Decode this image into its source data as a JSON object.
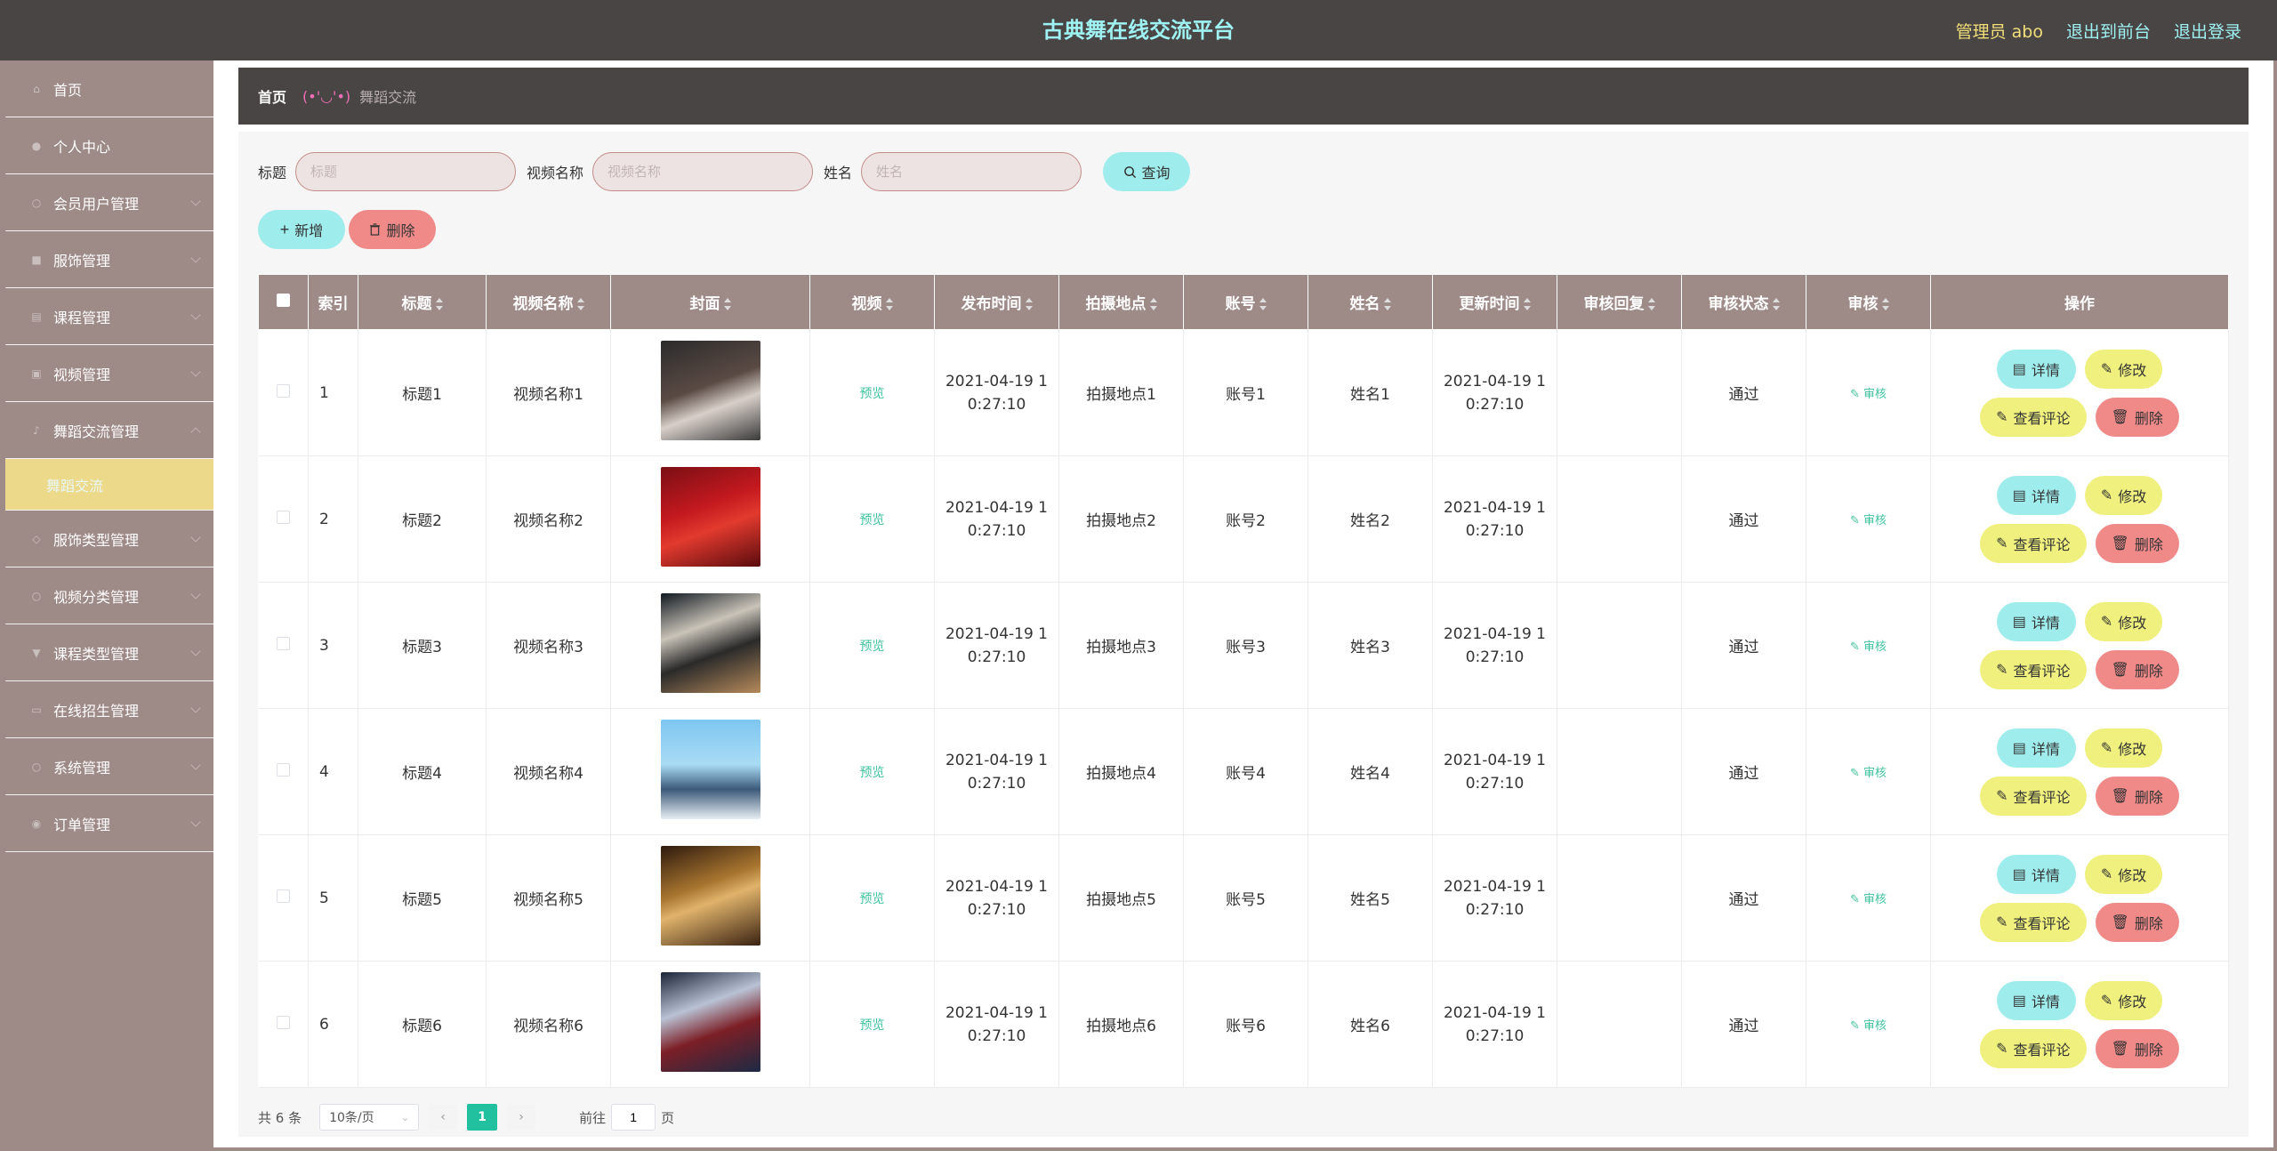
{
  "header": {
    "title": "古典舞在线交流平台",
    "admin_label": "管理员 abo",
    "to_front": "退出到前台",
    "logout": "退出登录"
  },
  "sidebar": {
    "items": [
      {
        "label": "首页",
        "icon": "home-icon"
      },
      {
        "label": "个人中心",
        "icon": "user-icon"
      },
      {
        "label": "会员用户管理",
        "icon": "users-icon"
      },
      {
        "label": "服饰管理",
        "icon": "shirt-icon"
      },
      {
        "label": "课程管理",
        "icon": "book-icon"
      },
      {
        "label": "视频管理",
        "icon": "video-icon"
      },
      {
        "label": "舞蹈交流管理",
        "icon": "chat-icon"
      },
      {
        "label": "舞蹈交流",
        "icon": ""
      },
      {
        "label": "服饰类型管理",
        "icon": "tag-icon"
      },
      {
        "label": "视频分类管理",
        "icon": "folder-icon"
      },
      {
        "label": "课程类型管理",
        "icon": "list-icon"
      },
      {
        "label": "在线招生管理",
        "icon": "school-icon"
      },
      {
        "label": "系统管理",
        "icon": "gear-icon"
      },
      {
        "label": "订单管理",
        "icon": "cart-icon"
      }
    ]
  },
  "breadcrumb": {
    "home": "首页",
    "separator": "(•'◡'•)",
    "current": "舞蹈交流"
  },
  "search": {
    "title_label": "标题",
    "title_placeholder": "标题",
    "video_label": "视频名称",
    "video_placeholder": "视频名称",
    "name_label": "姓名",
    "name_placeholder": "姓名",
    "query_button": "查询"
  },
  "actions": {
    "add": "新增",
    "delete": "删除"
  },
  "table": {
    "headers": {
      "index": "索引",
      "title": "标题",
      "video_name": "视频名称",
      "cover": "封面",
      "video": "视频",
      "publish_time": "发布时间",
      "location": "拍摄地点",
      "account": "账号",
      "name": "姓名",
      "update_time": "更新时间",
      "audit_reply": "审核回复",
      "audit_status": "审核状态",
      "audit": "审核",
      "ops": "操作"
    },
    "labels": {
      "preview": "预览",
      "audit_link": "审核",
      "detail": "详情",
      "edit": "修改",
      "comments": "查看评论",
      "delete": "删除"
    },
    "rows": [
      {
        "index": "1",
        "title": "标题1",
        "video_name": "视频名称1",
        "publish_time": "2021-04-19 10:27:10",
        "location": "拍摄地点1",
        "account": "账号1",
        "name": "姓名1",
        "update_time": "2021-04-19 10:27:10",
        "audit_reply": "",
        "audit_status": "通过"
      },
      {
        "index": "2",
        "title": "标题2",
        "video_name": "视频名称2",
        "publish_time": "2021-04-19 10:27:10",
        "location": "拍摄地点2",
        "account": "账号2",
        "name": "姓名2",
        "update_time": "2021-04-19 10:27:10",
        "audit_reply": "",
        "audit_status": "通过"
      },
      {
        "index": "3",
        "title": "标题3",
        "video_name": "视频名称3",
        "publish_time": "2021-04-19 10:27:10",
        "location": "拍摄地点3",
        "account": "账号3",
        "name": "姓名3",
        "update_time": "2021-04-19 10:27:10",
        "audit_reply": "",
        "audit_status": "通过"
      },
      {
        "index": "4",
        "title": "标题4",
        "video_name": "视频名称4",
        "publish_time": "2021-04-19 10:27:10",
        "location": "拍摄地点4",
        "account": "账号4",
        "name": "姓名4",
        "update_time": "2021-04-19 10:27:10",
        "audit_reply": "",
        "audit_status": "通过"
      },
      {
        "index": "5",
        "title": "标题5",
        "video_name": "视频名称5",
        "publish_time": "2021-04-19 10:27:10",
        "location": "拍摄地点5",
        "account": "账号5",
        "name": "姓名5",
        "update_time": "2021-04-19 10:27:10",
        "audit_reply": "",
        "audit_status": "通过"
      },
      {
        "index": "6",
        "title": "标题6",
        "video_name": "视频名称6",
        "publish_time": "2021-04-19 10:27:10",
        "location": "拍摄地点6",
        "account": "账号6",
        "name": "姓名6",
        "update_time": "2021-04-19 10:27:10",
        "audit_reply": "",
        "audit_status": "通过"
      }
    ]
  },
  "pagination": {
    "total": "共 6 条",
    "page_size": "10条/页",
    "current_page": "1",
    "goto_label": "前往",
    "goto_value": "1",
    "page_unit": "页"
  },
  "colors": {
    "header_bg": "#4a4545",
    "accent_cyan": "#9feced",
    "accent_yellow": "#eff07e",
    "accent_red": "#ef8a89",
    "table_header": "#9e8a87",
    "active_menu": "#ecd98a",
    "page_active": "#21c09e"
  }
}
